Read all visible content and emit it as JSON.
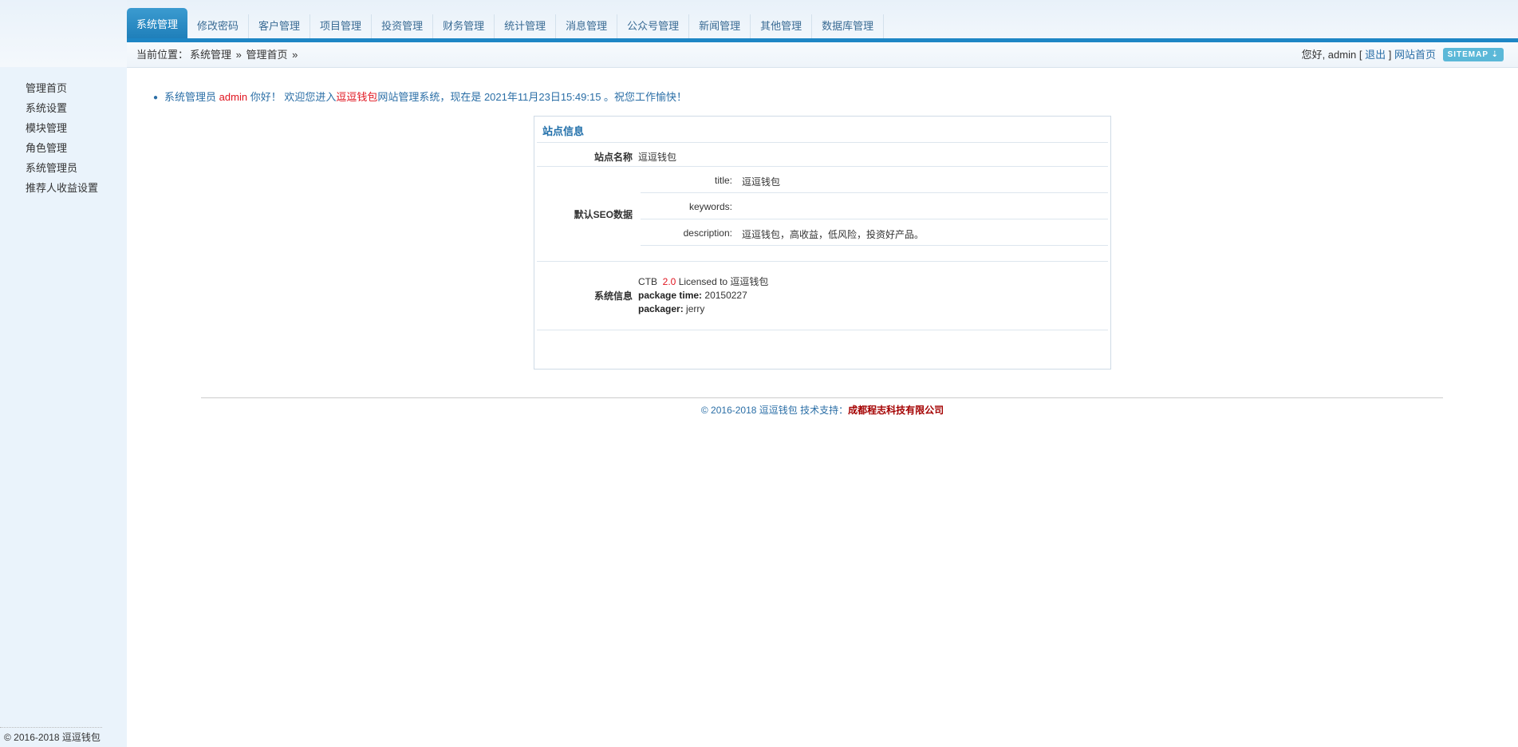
{
  "header": {
    "tabs": [
      {
        "label": "系统管理",
        "active": true
      },
      {
        "label": "修改密码"
      },
      {
        "label": "客户管理"
      },
      {
        "label": "项目管理"
      },
      {
        "label": "投资管理"
      },
      {
        "label": "财务管理"
      },
      {
        "label": "统计管理"
      },
      {
        "label": "消息管理"
      },
      {
        "label": "公众号管理"
      },
      {
        "label": "新闻管理"
      },
      {
        "label": "其他管理"
      },
      {
        "label": "数据库管理"
      }
    ],
    "breadcrumb": {
      "prefix": "当前位置：",
      "items": [
        "系统管理",
        "管理首页"
      ],
      "sep": "»"
    },
    "user": {
      "greeting": "您好, admin",
      "bracket_open": "[",
      "logout": "退出",
      "bracket_close": "]",
      "home_link": "网站首页"
    },
    "sitemap_label": "SITEMAP ⇣"
  },
  "sidebar": {
    "items": [
      "管理首页",
      "系统设置",
      "模块管理",
      "角色管理",
      "系统管理员",
      "推荐人收益设置"
    ],
    "copyright": "© 2016-2018 逗逗钱包"
  },
  "main": {
    "welcome": {
      "part1": "系统管理员 ",
      "user": "admin",
      "part2": " 你好！  欢迎您进入",
      "site": "逗逗钱包",
      "part3": "网站管理系统，现在是 2021年11月23日15:49:15 。祝您工作愉快！"
    },
    "info_box": {
      "title": "站点信息",
      "site_name_label": "站点名称",
      "site_name_value": "逗逗钱包",
      "seo_label": "默认SEO数据",
      "seo": {
        "title_label": "title:",
        "title_value": "逗逗钱包",
        "keywords_label": "keywords:",
        "keywords_value": "",
        "description_label": "description:",
        "description_value": "逗逗钱包，高收益，低风险，投资好产品。"
      },
      "sys_label": "系统信息",
      "sys": {
        "product": "CTB",
        "version": "2.0",
        "licensed": "Licensed to 逗逗钱包",
        "package_time_label": "package time:",
        "package_time_value": "20150227",
        "packager_label": "packager:",
        "packager_value": "jerry"
      }
    },
    "footer": {
      "text": "© 2016-2018 逗逗钱包 技术支持：",
      "company": "成都程志科技有限公司"
    }
  },
  "colors": {
    "accent": "#1e86c5",
    "link": "#2a6ea6",
    "highlight": "#e0141f",
    "sidebar_bg": "#eaf3fb"
  }
}
